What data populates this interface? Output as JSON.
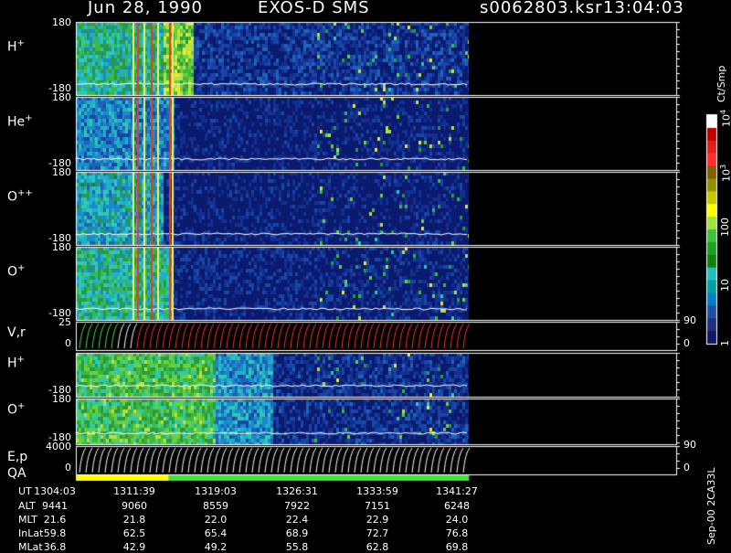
{
  "header": {
    "date": "Jun 28, 1990",
    "instrument": "EXOS-D SMS",
    "file": "s0062803.ksr",
    "time": "13:04:03"
  },
  "panels": [
    {
      "name": "H",
      "charge": "+",
      "ymax": "180",
      "ymin": "-180"
    },
    {
      "name": "He",
      "charge": "+",
      "ymax": "180",
      "ymin": "-180"
    },
    {
      "name": "O",
      "charge": "++",
      "ymax": "180",
      "ymin": "-180"
    },
    {
      "name": "O",
      "charge": "+",
      "ymax": "180",
      "ymin": "-180"
    },
    {
      "name": "V,r",
      "charge": "",
      "ymax": "25",
      "ymin": "0",
      "rmax": "90",
      "rmin": "0"
    },
    {
      "name": "H",
      "charge": "+",
      "ymax": "",
      "ymin": "-180"
    },
    {
      "name": "O",
      "charge": "+",
      "ymax": "180",
      "ymin": "-180"
    },
    {
      "name": "E,p",
      "charge": "",
      "ymax": "4000",
      "ymin": "0",
      "rmax": "90",
      "rmin": "0"
    }
  ],
  "qa_label": "QA",
  "colorbar": {
    "unit": "Ct/Smp",
    "ticks": [
      "10",
      "10",
      "100",
      "10",
      "1"
    ],
    "ticks_exp": [
      "4",
      "3",
      "",
      "",
      ""
    ],
    "colors": [
      "#ffffff",
      "#c00000",
      "#e02020",
      "#ff3030",
      "#806000",
      "#909000",
      "#c8c800",
      "#ffff00",
      "#a0e040",
      "#40c040",
      "#20a020",
      "#108010",
      "#20c0c0",
      "#00a0a0",
      "#0080c0",
      "#2050a0",
      "#203080",
      "#101860"
    ]
  },
  "ephemeris": {
    "labels": [
      "UT",
      "ALT",
      "MLT",
      "InLat",
      "MLat"
    ],
    "columns": [
      [
        "1304:03",
        "9441",
        "21.6",
        "59.8",
        "36.8"
      ],
      [
        "1311:39",
        "9060",
        "21.8",
        "62.5",
        "42.9"
      ],
      [
        "1319:03",
        "8559",
        "22.0",
        "65.4",
        "49.2"
      ],
      [
        "1326:31",
        "7922",
        "22.4",
        "68.9",
        "55.8"
      ],
      [
        "1333:59",
        "7151",
        "22.9",
        "72.7",
        "62.8"
      ],
      [
        "1341:27",
        "6248",
        "24.0",
        "76.8",
        "69.8"
      ]
    ]
  },
  "side_note": "Sep-00 2CA33L",
  "chart_data": {
    "type": "heatmap",
    "title": "Jun 28, 1990   EXOS-D SMS",
    "x_ticks": [
      "1304:03",
      "1311:39",
      "1319:03",
      "1326:31",
      "1333:59",
      "1341:27"
    ],
    "data_end_fraction": 0.655,
    "qa_segments": [
      {
        "from": 0.0,
        "to": 0.155,
        "color": "#ffff00"
      },
      {
        "from": 0.155,
        "to": 0.655,
        "color": "#40e040"
      }
    ],
    "colorscale": "log, 1 to 10^4 Ct/Smp"
  }
}
